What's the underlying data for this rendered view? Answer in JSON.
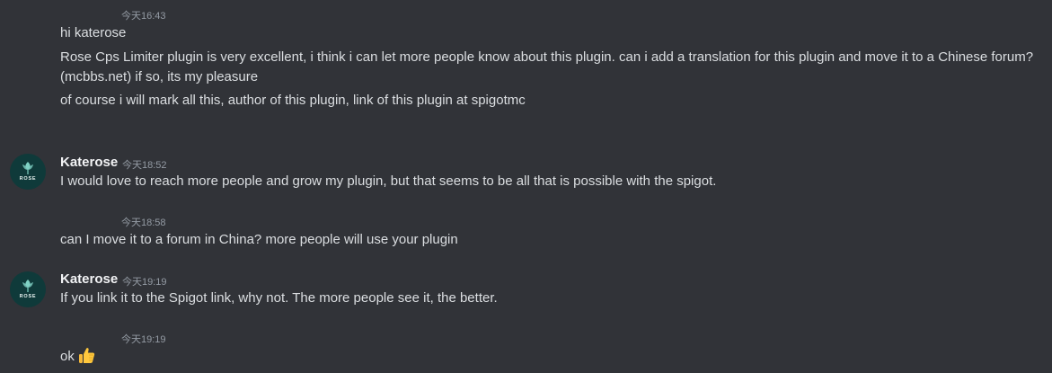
{
  "messages": [
    {
      "timestamp": "今天16:43",
      "lines": [
        "hi katerose",
        "Rose Cps Limiter plugin is very excellent, i think i can let more people know about this plugin. can i add a translation for this plugin and move it to a Chinese forum?",
        "(mcbbs.net) if so, its my pleasure",
        "of course i will mark all this, author of this plugin, link of this plugin at spigotmc"
      ]
    },
    {
      "author": "Katerose",
      "avatar_label": "ROSE",
      "timestamp": "今天18:52",
      "lines": [
        "I would love to reach more people and grow my plugin, but that seems to be all that is possible with the spigot."
      ]
    },
    {
      "timestamp": "今天18:58",
      "lines": [
        "can I move it to a forum in China? more people will use your plugin"
      ]
    },
    {
      "author": "Katerose",
      "avatar_label": "ROSE",
      "timestamp": "今天19:19",
      "lines": [
        "If you link it to the Spigot link, why not. The more people see it, the better."
      ]
    },
    {
      "timestamp": "今天19:19",
      "lines": [
        "ok"
      ],
      "emoji": "thumbs-up"
    }
  ],
  "colors": {
    "background": "#313338",
    "text": "#dbdee1",
    "username": "#f2f3f5",
    "timestamp": "#949ba4",
    "avatar_bg": "#0f3a3a",
    "avatar_fg": "#7fd1c4"
  }
}
